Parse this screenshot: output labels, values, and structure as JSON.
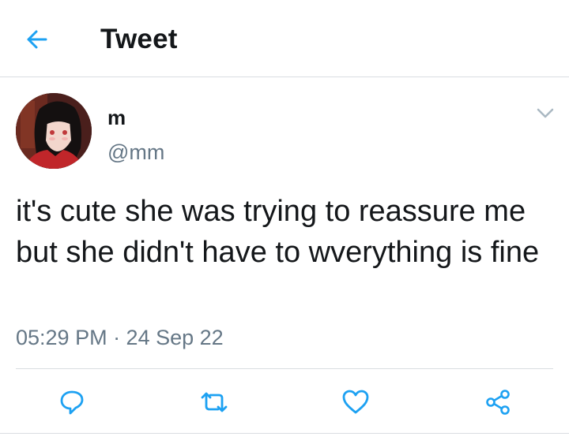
{
  "header": {
    "title": "Tweet",
    "back_icon": "arrow-left-icon"
  },
  "tweet": {
    "author_name": "m",
    "author_handle": "@mm",
    "text": "it's cute she was trying to reassure me but she didn't have to wverything is fine",
    "timestamp": "05:29 PM · 24 Sep 22"
  },
  "actions": {
    "icons": [
      "reply-icon",
      "retweet-icon",
      "like-icon",
      "share-icon"
    ]
  },
  "colors": {
    "accent": "#1da1f2",
    "text_primary": "#14171a",
    "text_secondary": "#657786",
    "divider": "#d9dde1"
  }
}
